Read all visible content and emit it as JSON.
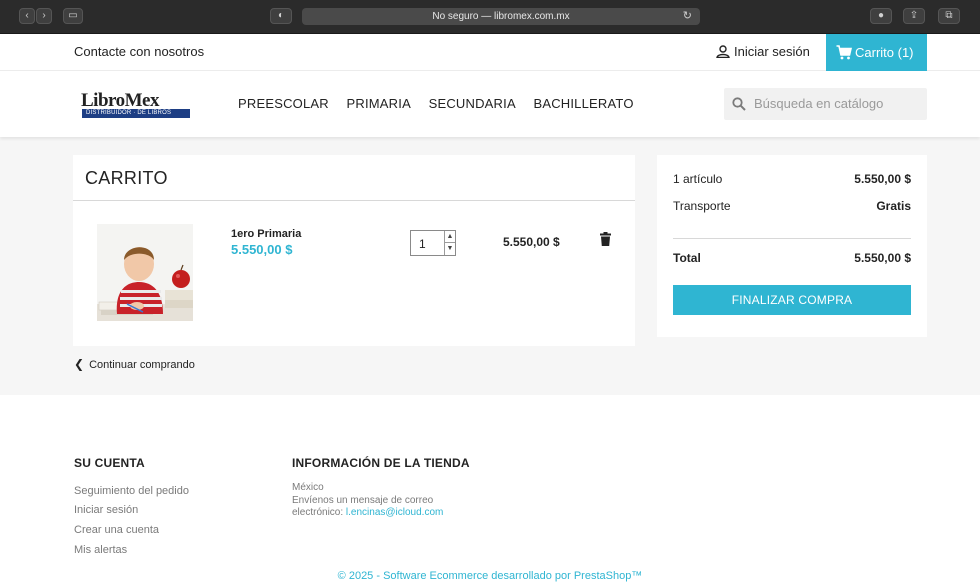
{
  "browser": {
    "url_text": "No seguro — libromex.com.mx",
    "back_label": "‹",
    "forward_label": "›",
    "sidebar_label": "▭",
    "shield_label": "◐",
    "reload_label": "↻",
    "download_label": "●",
    "share_label": "⇪",
    "tabs_label": "⧉"
  },
  "topbar": {
    "contact": "Contacte con nosotros",
    "signin": "Iniciar sesión",
    "cart": "Carrito (1)"
  },
  "header": {
    "logo_text": "LibroMex",
    "logo_band": "DISTRIBUIDOR · DE LIBROS",
    "nav": [
      "PREESCOLAR",
      "PRIMARIA",
      "SECUNDARIA",
      "BACHILLERATO"
    ],
    "search_placeholder": "Búsqueda en catálogo"
  },
  "cart": {
    "title": "CARRITO",
    "item": {
      "name": "1ero Primaria",
      "price": "5.550,00 $",
      "quantity": "1",
      "line_total": "5.550,00 $"
    },
    "continue": "Continuar comprando"
  },
  "summary": {
    "items_label": "1 artículo",
    "items_value": "5.550,00 $",
    "shipping_label": "Transporte",
    "shipping_value": "Gratis",
    "total_label": "Total",
    "total_value": "5.550,00 $",
    "checkout": "FINALIZAR COMPRA"
  },
  "footer": {
    "account_heading": "SU CUENTA",
    "account_links": [
      "Seguimiento del pedido",
      "Iniciar sesión",
      "Crear una cuenta",
      "Mis alertas"
    ],
    "store_heading": "INFORMACIÓN DE LA TIENDA",
    "store_country": "México",
    "store_line2": "Envíenos un mensaje de correo",
    "store_line3": "electrónico:",
    "store_email": "l.encinas@icloud.com",
    "copyright": "© 2025 - Software Ecommerce desarrollado por PrestaShop™"
  },
  "colors": {
    "accent": "#2fb5d2",
    "background": "#f6f6f6"
  }
}
